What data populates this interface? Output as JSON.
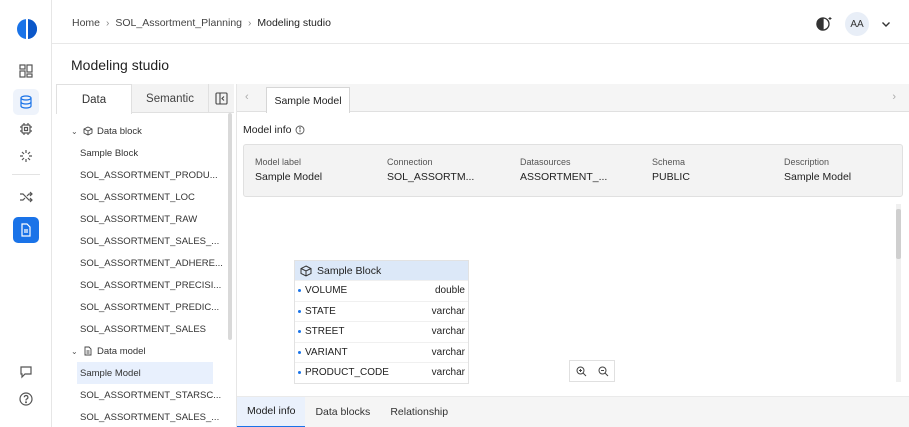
{
  "breadcrumb": {
    "items": [
      "Home",
      "SOL_Assortment_Planning",
      "Modeling studio"
    ]
  },
  "user": {
    "initials": "AA"
  },
  "page": {
    "title": "Modeling studio"
  },
  "left_panel": {
    "tabs": [
      "Data",
      "Semantic"
    ],
    "active_tab": "Data",
    "groups": [
      {
        "label": "Data block",
        "icon": "cube-icon",
        "items": [
          "Sample Block",
          "SOL_ASSORTMENT_PRODU...",
          "SOL_ASSORTMENT_LOC",
          "SOL_ASSORTMENT_RAW",
          "SOL_ASSORTMENT_SALES_...",
          "SOL_ASSORTMENT_ADHERE...",
          "SOL_ASSORTMENT_PRECISI...",
          "SOL_ASSORTMENT_PREDIC...",
          "SOL_ASSORTMENT_SALES"
        ]
      },
      {
        "label": "Data model",
        "icon": "document-icon",
        "items": [
          "Sample Model",
          "SOL_ASSORTMENT_STARSC...",
          "SOL_ASSORTMENT_SALES_..."
        ],
        "selected": "Sample Model"
      }
    ]
  },
  "model_tab": {
    "label": "Sample Model"
  },
  "model_info": {
    "title": "Model info",
    "fields": [
      {
        "label": "Model label",
        "value": "Sample Model"
      },
      {
        "label": "Connection",
        "value": "SOL_ASSORTM..."
      },
      {
        "label": "Datasources",
        "value": "ASSORTMENT_..."
      },
      {
        "label": "Schema",
        "value": "PUBLIC"
      },
      {
        "label": "Description",
        "value": "Sample Model"
      }
    ]
  },
  "block_card": {
    "title": "Sample Block",
    "fields": [
      {
        "name": "VOLUME",
        "type": "double"
      },
      {
        "name": "STATE",
        "type": "varchar"
      },
      {
        "name": "STREET",
        "type": "varchar"
      },
      {
        "name": "VARIANT",
        "type": "varchar"
      },
      {
        "name": "PRODUCT_CODE",
        "type": "varchar"
      }
    ]
  },
  "bottom_tabs": [
    "Model info",
    "Data blocks",
    "Relationship"
  ],
  "active_bottom_tab": "Model info",
  "colors": {
    "accent": "#1a73e8",
    "block_header": "#dce8f8"
  }
}
